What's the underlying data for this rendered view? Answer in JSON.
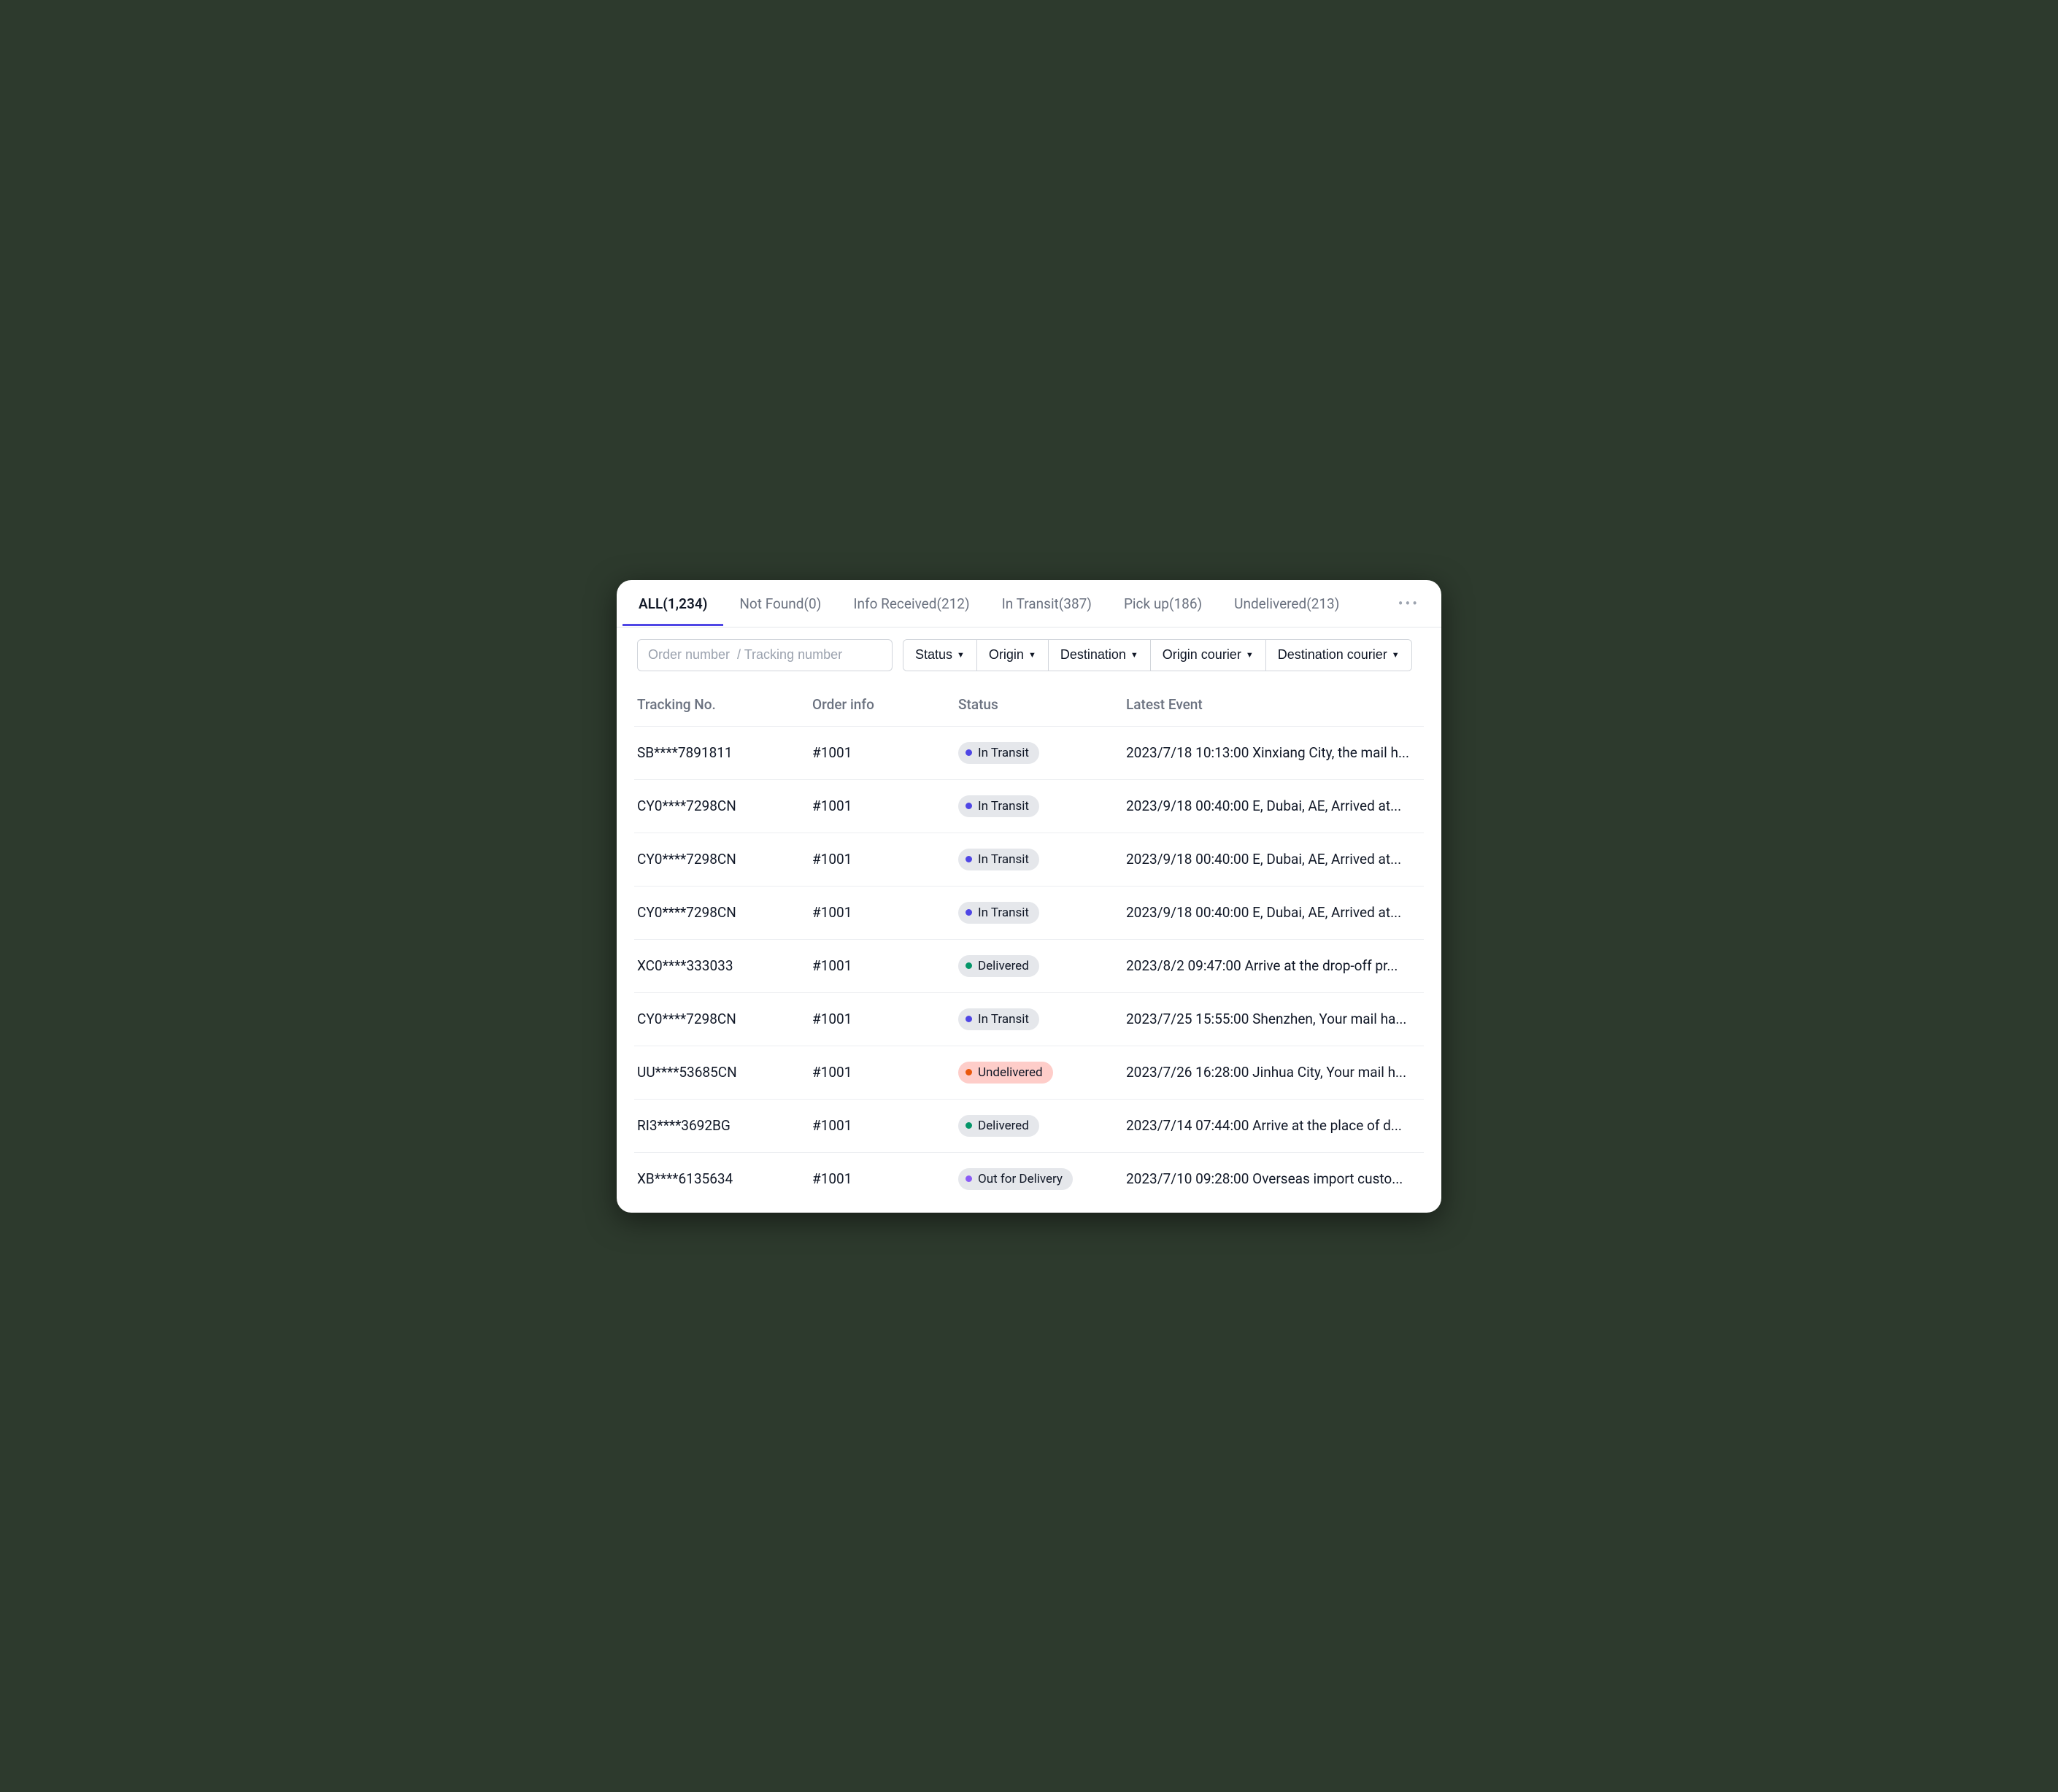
{
  "tabs": [
    {
      "label": "ALL(1,234)",
      "active": true
    },
    {
      "label": "Not Found(0)"
    },
    {
      "label": "Info Received(212)"
    },
    {
      "label": "In Transit(387)"
    },
    {
      "label": "Pick up(186)"
    },
    {
      "label": "Undelivered(213)"
    }
  ],
  "search": {
    "placeholder": "Order number  / Tracking number"
  },
  "filters": {
    "status": "Status",
    "origin": "Origin",
    "destination": "Destination",
    "origin_courier": "Origin courier",
    "destination_courier": "Destination courier"
  },
  "columns": {
    "tracking": "Tracking No.",
    "order": "Order info",
    "status": "Status",
    "event": "Latest Event"
  },
  "rows": [
    {
      "tracking": "SB****7891811",
      "order": "#1001",
      "status": "In Transit",
      "color": "blue",
      "event": "2023/7/18 10:13:00 Xinxiang City, the mail h..."
    },
    {
      "tracking": "CY0****7298CN",
      "order": "#1001",
      "status": "In Transit",
      "color": "blue",
      "event": "2023/9/18 00:40:00 E, Dubai, AE, Arrived at..."
    },
    {
      "tracking": "CY0****7298CN",
      "order": "#1001",
      "status": "In Transit",
      "color": "blue",
      "event": "2023/9/18 00:40:00 E, Dubai, AE, Arrived at..."
    },
    {
      "tracking": "CY0****7298CN",
      "order": "#1001",
      "status": "In Transit",
      "color": "blue",
      "event": "2023/9/18 00:40:00 E, Dubai, AE, Arrived at..."
    },
    {
      "tracking": "XC0****333033",
      "order": "#1001",
      "status": "Delivered",
      "color": "green",
      "event": "2023/8/2 09:47:00 Arrive at the drop-off pr..."
    },
    {
      "tracking": "CY0****7298CN",
      "order": "#1001",
      "status": "In Transit",
      "color": "blue",
      "event": "2023/7/25 15:55:00 Shenzhen, Your mail ha..."
    },
    {
      "tracking": "UU****53685CN",
      "order": "#1001",
      "status": "Undelivered",
      "color": "orange",
      "event": "2023/7/26 16:28:00 Jinhua City, Your mail h..."
    },
    {
      "tracking": "RI3****3692BG",
      "order": "#1001",
      "status": "Delivered",
      "color": "green",
      "event": "2023/7/14 07:44:00 Arrive at the place of d..."
    },
    {
      "tracking": "XB****6135634",
      "order": "#1001",
      "status": "Out for Delivery",
      "color": "purple",
      "event": "2023/7/10 09:28:00 Overseas import custo..."
    }
  ]
}
